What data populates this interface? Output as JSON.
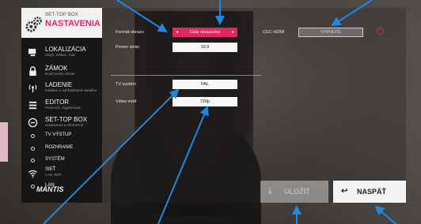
{
  "header": {
    "small_title": "SET-TOP BOX",
    "title": "NASTAVENIA"
  },
  "sidebar": {
    "items": [
      {
        "label": "LOKALIZÁCIA",
        "sub": "Jazyk, Dátum, Čas",
        "icon": "monitor-icon"
      },
      {
        "label": "ZÁMOK",
        "sub": "Rodičovský zámok",
        "icon": "lock-icon"
      },
      {
        "label": "LADENIE",
        "sub": "Intalácie a vyhľadávanie kanálov",
        "icon": "antenna-icon"
      },
      {
        "label": "EDITOR",
        "sub": "Presunúť, organizovať...",
        "icon": "list-icon"
      },
      {
        "label": "SET-TOP BOX",
        "sub": "Nastavenia a informácie",
        "icon": "settop-icon"
      }
    ],
    "subitems": [
      "TV VÝSTUP",
      "ROZHRANIE",
      "SYSTÉM",
      "SIEŤ",
      "LAN"
    ],
    "network_sub": "LAN, WiFi",
    "brand": "MANTIS"
  },
  "form": {
    "format_label": "Formát obrazu",
    "format_value": "Celá obrazovka",
    "aspect_label": "Pomer strán",
    "aspect_value": "16:9",
    "cec_label": "CEC-HDMI",
    "cec_value": "VYPNUTÉ",
    "tv_system_label": "TV systém",
    "tv_system_value": "PAL",
    "video_mode_label": "Video mód",
    "video_mode_value": "720p"
  },
  "buttons": {
    "save": "ULOŽIŤ",
    "back": "NASPÄŤ"
  },
  "colors": {
    "accent": "#e2265f",
    "callout": "#1e88e5"
  }
}
